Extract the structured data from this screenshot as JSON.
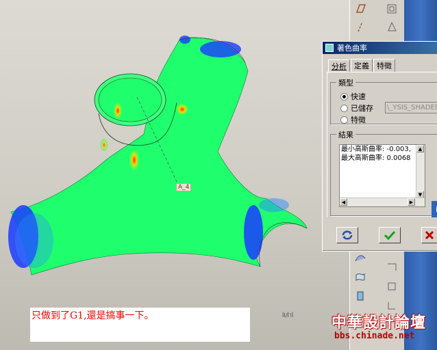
{
  "viewport": {
    "axis_label": "A_4",
    "note_text": "只做到了G1,還是搞事一下。",
    "scale_mark": "ꟾI/ꟾ˥ꟾ"
  },
  "dialog": {
    "title": "著色曲率",
    "tabs": [
      {
        "label": "分析",
        "active": true
      },
      {
        "label": "定義",
        "active": false
      },
      {
        "label": "特徵",
        "active": false
      }
    ],
    "type_group": {
      "title": "類型",
      "options": [
        {
          "label": "快速",
          "checked": true
        },
        {
          "label": "已儲存",
          "checked": false
        },
        {
          "label": "特徵",
          "checked": false
        }
      ],
      "saved_field_value": "\\_YSIS_SHADED_"
    },
    "results_group": {
      "title": "結果",
      "lines": [
        "最小高斯曲率: -0.003,",
        "最大高斯曲率: 0.0068"
      ]
    },
    "info_label": "i"
  },
  "watermark": {
    "main": "中華設計論壇",
    "url": "bbs.chinade.net"
  },
  "icons": {
    "repaint": "repaint-icon",
    "ok": "check-icon",
    "close": "close-x-icon"
  },
  "colors": {
    "surface_green": "#1fff6e",
    "curvature_blue": "#1a3cff",
    "curvature_red": "#ff3b00",
    "title_bar": "#0a246a",
    "ok_green": "#1aa01a",
    "close_red": "#c00000"
  }
}
